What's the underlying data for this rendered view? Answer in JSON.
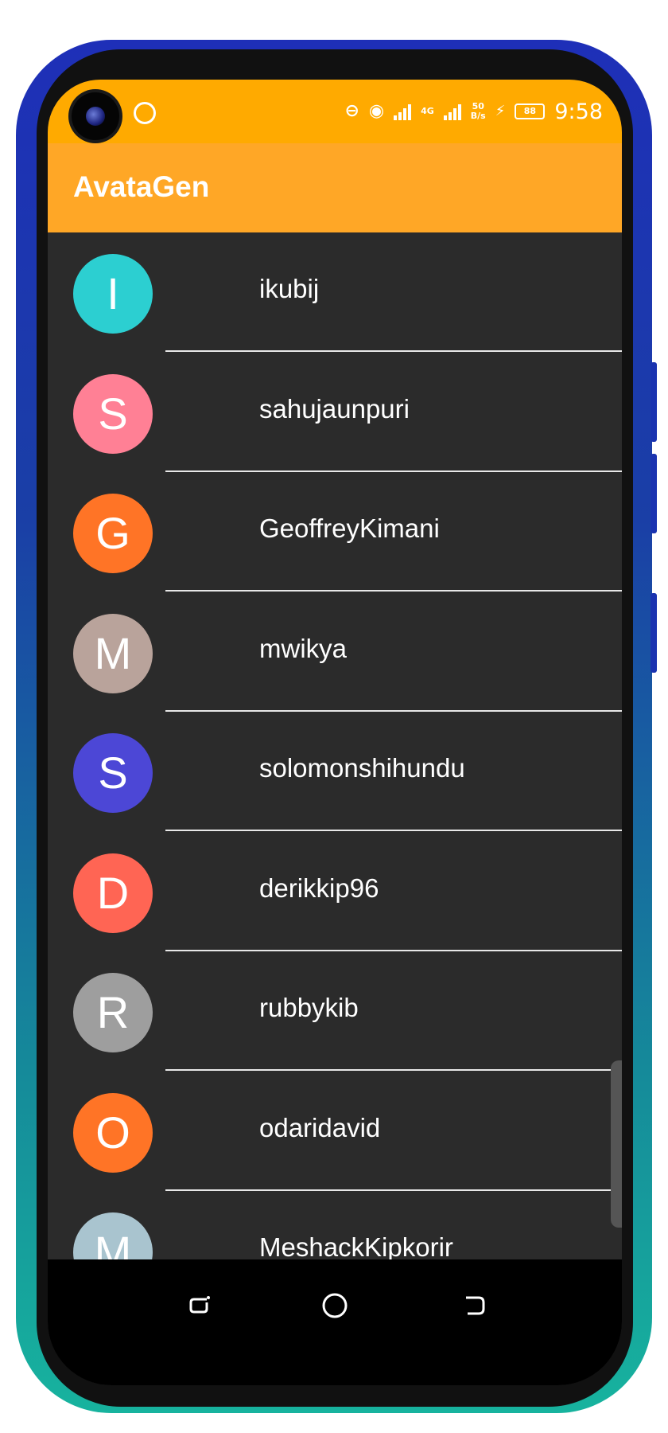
{
  "status_bar": {
    "time": "9:58",
    "network_type": "4G",
    "net_speed_value": "50",
    "net_speed_unit": "B/s",
    "battery_level": "88"
  },
  "app_bar": {
    "title": "AvataGen"
  },
  "users": [
    {
      "initial": "I",
      "name": "ikubij",
      "color": "#2ccfd1"
    },
    {
      "initial": "S",
      "name": "sahujaunpuri",
      "color": "#ff8095"
    },
    {
      "initial": "G",
      "name": "GeoffreyKimani",
      "color": "#ff7426"
    },
    {
      "initial": "M",
      "name": "mwikya",
      "color": "#b9a39b"
    },
    {
      "initial": "S",
      "name": "solomonshihundu",
      "color": "#4c47d6"
    },
    {
      "initial": "D",
      "name": "derikkip96",
      "color": "#ff6554"
    },
    {
      "initial": "R",
      "name": "rubbykib",
      "color": "#9e9e9e"
    },
    {
      "initial": "O",
      "name": "odaridavid",
      "color": "#ff7426"
    },
    {
      "initial": "M",
      "name": "MeshackKipkorir",
      "color": "#a9c4cf"
    }
  ],
  "colors": {
    "status_bar": "#ffaa00",
    "app_bar": "#ffa726",
    "list_background": "#2b2b2b"
  }
}
